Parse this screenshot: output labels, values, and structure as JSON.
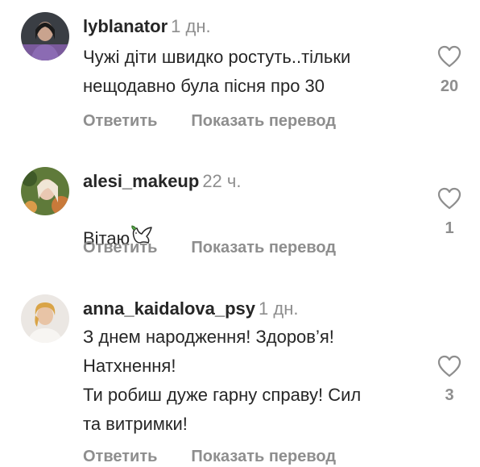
{
  "comments": [
    {
      "username": "lyblanator",
      "time": "1 дн.",
      "text": "Чужі діти швидко ростуть..тільки\nнещодавно була пісня про 30",
      "likes": "20",
      "reply_label": "Ответить",
      "translate_label": "Показать перевод"
    },
    {
      "username": "alesi_makeup",
      "time": "22 ч.",
      "text": "Вітаю",
      "emoji": "dove-emoji",
      "likes": "1",
      "reply_label": "Ответить",
      "translate_label": "Показать перевод"
    },
    {
      "username": "anna_kaidalova_psy",
      "time": "1 дн.",
      "text": "З днем народження! Здоров’я!\nНатхнення!\nТи робиш дуже гарну справу! Сил\nта витримки!",
      "likes": "3",
      "reply_label": "Ответить",
      "translate_label": "Показать перевод"
    }
  ],
  "icons": {
    "like": "heart-outline-icon"
  },
  "colors": {
    "primary_text": "#262626",
    "secondary_text": "#8e8e8e",
    "background": "#ffffff"
  }
}
